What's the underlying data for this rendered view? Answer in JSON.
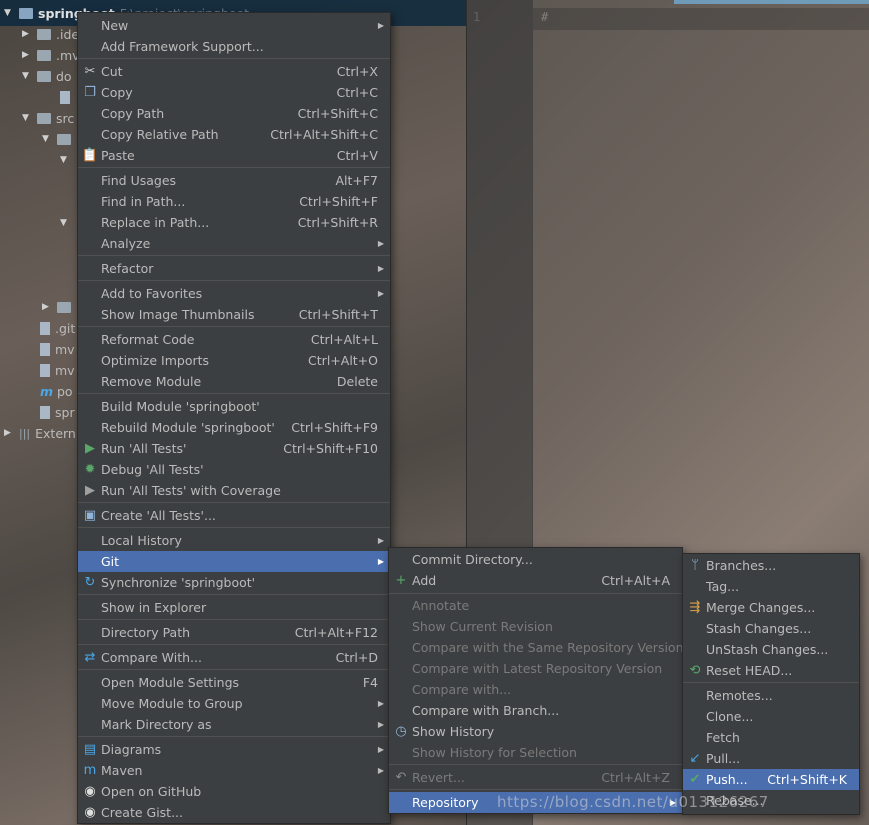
{
  "project_tree": {
    "root_name": "springboot",
    "root_path": "F:\\project\\springboot",
    "rows": [
      {
        "label": ".ide"
      },
      {
        "label": ".mv"
      },
      {
        "label": "do"
      },
      {
        "label": "src"
      },
      {
        "label": ".git"
      },
      {
        "label": "mv"
      },
      {
        "label": "mv"
      },
      {
        "label": "po"
      },
      {
        "label": "spr"
      },
      {
        "label": "Extern"
      }
    ]
  },
  "editor": {
    "line_number": "1",
    "first_line_text": "#"
  },
  "context_menu": {
    "items": [
      {
        "label": "New",
        "shortcut": "",
        "submenu": true,
        "icon": ""
      },
      {
        "label": "Add Framework Support...",
        "shortcut": "",
        "icon": ""
      },
      {
        "label": "Cut",
        "shortcut": "Ctrl+X",
        "icon": "scissors-icon"
      },
      {
        "label": "Copy",
        "shortcut": "Ctrl+C",
        "icon": "copy-icon"
      },
      {
        "label": "Copy Path",
        "shortcut": "Ctrl+Shift+C",
        "icon": ""
      },
      {
        "label": "Copy Relative Path",
        "shortcut": "Ctrl+Alt+Shift+C",
        "icon": ""
      },
      {
        "label": "Paste",
        "shortcut": "Ctrl+V",
        "icon": "paste-icon"
      },
      {
        "label": "Find Usages",
        "shortcut": "Alt+F7",
        "icon": ""
      },
      {
        "label": "Find in Path...",
        "shortcut": "Ctrl+Shift+F",
        "icon": ""
      },
      {
        "label": "Replace in Path...",
        "shortcut": "Ctrl+Shift+R",
        "icon": ""
      },
      {
        "label": "Analyze",
        "shortcut": "",
        "submenu": true,
        "icon": ""
      },
      {
        "label": "Refactor",
        "shortcut": "",
        "submenu": true,
        "icon": ""
      },
      {
        "label": "Add to Favorites",
        "shortcut": "",
        "submenu": true,
        "icon": ""
      },
      {
        "label": "Show Image Thumbnails",
        "shortcut": "Ctrl+Shift+T",
        "icon": ""
      },
      {
        "label": "Reformat Code",
        "shortcut": "Ctrl+Alt+L",
        "icon": ""
      },
      {
        "label": "Optimize Imports",
        "shortcut": "Ctrl+Alt+O",
        "icon": ""
      },
      {
        "label": "Remove Module",
        "shortcut": "Delete",
        "icon": ""
      },
      {
        "label": "Build Module 'springboot'",
        "shortcut": "",
        "icon": ""
      },
      {
        "label": "Rebuild Module 'springboot'",
        "shortcut": "Ctrl+Shift+F9",
        "icon": ""
      },
      {
        "label": "Run 'All Tests'",
        "shortcut": "Ctrl+Shift+F10",
        "icon": "run-icon"
      },
      {
        "label": "Debug 'All Tests'",
        "shortcut": "",
        "icon": "debug-icon"
      },
      {
        "label": "Run 'All Tests' with Coverage",
        "shortcut": "",
        "icon": "coverage-icon"
      },
      {
        "label": "Create 'All Tests'...",
        "shortcut": "",
        "icon": "test-config-icon"
      },
      {
        "label": "Local History",
        "shortcut": "",
        "submenu": true,
        "icon": ""
      },
      {
        "label": "Git",
        "shortcut": "",
        "submenu": true,
        "icon": "",
        "selected": true
      },
      {
        "label": "Synchronize 'springboot'",
        "shortcut": "",
        "icon": "sync-icon"
      },
      {
        "label": "Show in Explorer",
        "shortcut": "",
        "icon": ""
      },
      {
        "label": "Directory Path",
        "shortcut": "Ctrl+Alt+F12",
        "icon": ""
      },
      {
        "label": "Compare With...",
        "shortcut": "Ctrl+D",
        "icon": "compare-icon"
      },
      {
        "label": "Open Module Settings",
        "shortcut": "F4",
        "icon": ""
      },
      {
        "label": "Move Module to Group",
        "shortcut": "",
        "submenu": true,
        "icon": ""
      },
      {
        "label": "Mark Directory as",
        "shortcut": "",
        "submenu": true,
        "icon": ""
      },
      {
        "label": "Diagrams",
        "shortcut": "",
        "submenu": true,
        "icon": "diagram-icon"
      },
      {
        "label": "Maven",
        "shortcut": "",
        "submenu": true,
        "icon": "maven-icon"
      },
      {
        "label": "Open on GitHub",
        "shortcut": "",
        "icon": "github-icon"
      },
      {
        "label": "Create Gist...",
        "shortcut": "",
        "icon": "github-icon"
      }
    ]
  },
  "git_menu": {
    "items": [
      {
        "label": "Commit Directory...",
        "shortcut": "",
        "icon": ""
      },
      {
        "label": "Add",
        "shortcut": "Ctrl+Alt+A",
        "icon": "plus-icon"
      },
      {
        "label": "Annotate",
        "shortcut": "",
        "disabled": true,
        "icon": ""
      },
      {
        "label": "Show Current Revision",
        "shortcut": "",
        "disabled": true,
        "icon": ""
      },
      {
        "label": "Compare with the Same Repository Version",
        "shortcut": "",
        "disabled": true,
        "icon": ""
      },
      {
        "label": "Compare with Latest Repository Version",
        "shortcut": "",
        "disabled": true,
        "icon": ""
      },
      {
        "label": "Compare with...",
        "shortcut": "",
        "disabled": true,
        "icon": ""
      },
      {
        "label": "Compare with Branch...",
        "shortcut": "",
        "icon": ""
      },
      {
        "label": "Show History",
        "shortcut": "",
        "icon": "history-icon"
      },
      {
        "label": "Show History for Selection",
        "shortcut": "",
        "disabled": true,
        "icon": ""
      },
      {
        "label": "Revert...",
        "shortcut": "Ctrl+Alt+Z",
        "disabled": true,
        "icon": "revert-icon"
      },
      {
        "label": "Repository",
        "shortcut": "",
        "submenu": true,
        "selected": true,
        "icon": ""
      }
    ]
  },
  "repo_menu": {
    "items": [
      {
        "label": "Branches...",
        "shortcut": "",
        "icon": "branch-icon"
      },
      {
        "label": "Tag...",
        "shortcut": "",
        "icon": ""
      },
      {
        "label": "Merge Changes...",
        "shortcut": "",
        "icon": "merge-icon"
      },
      {
        "label": "Stash Changes...",
        "shortcut": "",
        "icon": ""
      },
      {
        "label": "UnStash Changes...",
        "shortcut": "",
        "icon": ""
      },
      {
        "label": "Reset HEAD...",
        "shortcut": "",
        "icon": "reset-icon"
      },
      {
        "label": "Remotes...",
        "shortcut": "",
        "icon": ""
      },
      {
        "label": "Clone...",
        "shortcut": "",
        "icon": ""
      },
      {
        "label": "Fetch",
        "shortcut": "",
        "icon": ""
      },
      {
        "label": "Pull...",
        "shortcut": "",
        "icon": "pull-icon"
      },
      {
        "label": "Push...",
        "shortcut": "Ctrl+Shift+K",
        "selected": true,
        "icon": "push-icon"
      },
      {
        "label": "Rebase...",
        "shortcut": "",
        "icon": ""
      }
    ]
  },
  "watermark": "https://blog.csdn.net/u013126267"
}
